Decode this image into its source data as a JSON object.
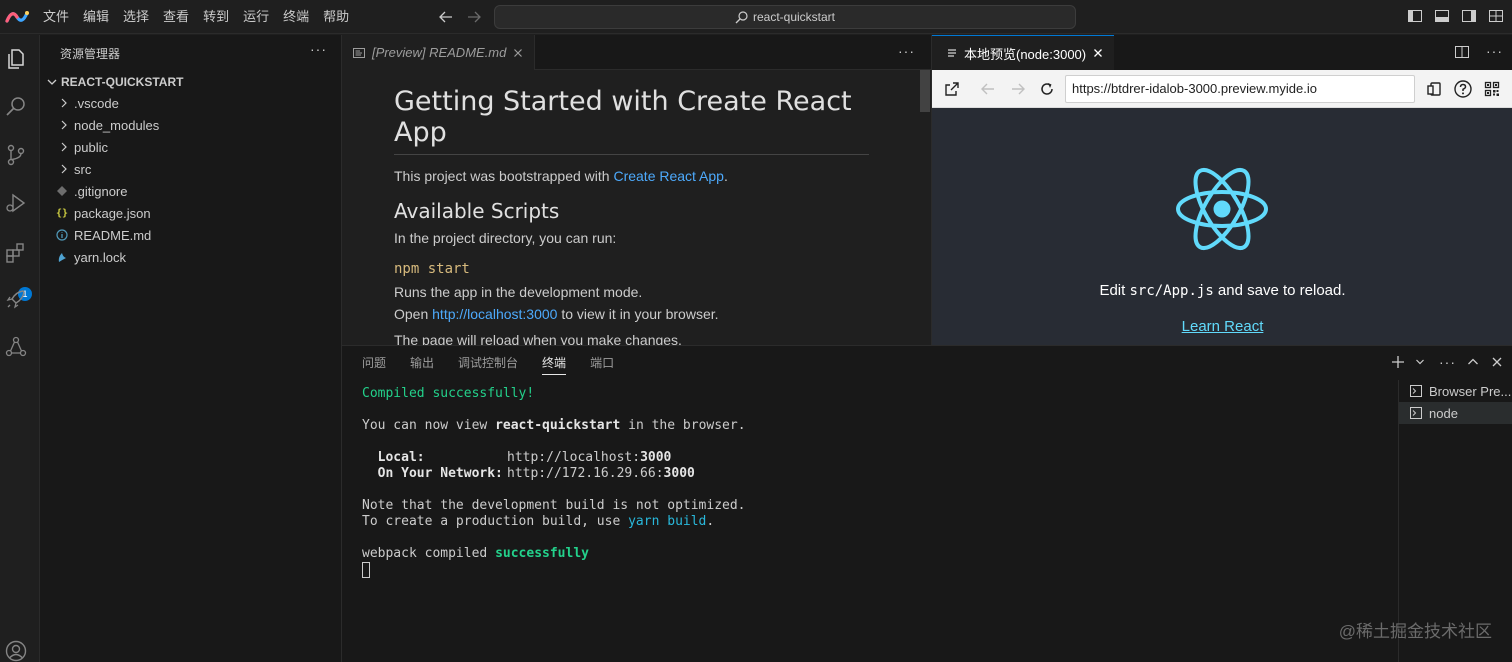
{
  "titlebar": {
    "menu": [
      "文件",
      "编辑",
      "选择",
      "查看",
      "转到",
      "运行",
      "终端",
      "帮助"
    ],
    "command_center": "react-quickstart"
  },
  "activitybar": {
    "extensions_badge": "1"
  },
  "sidebar": {
    "title": "资源管理器",
    "more": "···",
    "project": "REACT-QUICKSTART",
    "items": [
      {
        "label": ".vscode",
        "type": "folder"
      },
      {
        "label": "node_modules",
        "type": "folder"
      },
      {
        "label": "public",
        "type": "folder"
      },
      {
        "label": "src",
        "type": "folder"
      },
      {
        "label": ".gitignore",
        "type": "file"
      },
      {
        "label": "package.json",
        "type": "file"
      },
      {
        "label": "README.md",
        "type": "file"
      },
      {
        "label": "yarn.lock",
        "type": "file"
      }
    ]
  },
  "editor": {
    "tab_label": "[Preview] README.md",
    "more": "···",
    "md": {
      "h1": "Getting Started with Create React App",
      "p1_before": "This project was bootstrapped with ",
      "p1_link": "Create React App",
      "p1_after": ".",
      "h2": "Available Scripts",
      "p2": "In the project directory, you can run:",
      "h3": "npm start",
      "p3": "Runs the app in the development mode.",
      "p4_before": "Open ",
      "p4_link": "http://localhost:3000",
      "p4_after": " to view it in your browser.",
      "p5": "The page will reload when you make changes."
    }
  },
  "preview": {
    "tab_label": "本地预览(node:3000)",
    "url": "https://btdrer-idalob-3000.preview.myide.io",
    "page_text_before": "Edit ",
    "page_text_code": "src/App.js",
    "page_text_after": " and save to reload.",
    "page_link": "Learn React"
  },
  "panel": {
    "tabs": [
      "问题",
      "输出",
      "调试控制台",
      "终端",
      "端口"
    ],
    "active_tab": "终端",
    "terminal": {
      "l1": "Compiled successfully!",
      "l2_a": "You can now view ",
      "l2_b": "react-quickstart",
      "l2_c": " in the browser.",
      "local_label": "  Local:",
      "local_url_a": "http://localhost:",
      "local_url_b": "3000",
      "net_label": "  On Your Network:",
      "net_url_a": "http://172.16.29.66:",
      "net_url_b": "3000",
      "l5": "Note that the development build is not optimized.",
      "l6_a": "To create a production build, use ",
      "l6_b": "yarn build",
      "l6_c": ".",
      "l7_a": "webpack compiled ",
      "l7_b": "successfully"
    },
    "terminals": [
      "Browser Pre...",
      "node"
    ]
  },
  "watermark": "@稀土掘金技术社区",
  "colors": {
    "accent": "#0078d4",
    "link": "#4daafc",
    "react": "#61dafb",
    "terminal_green": "#23d18b"
  }
}
